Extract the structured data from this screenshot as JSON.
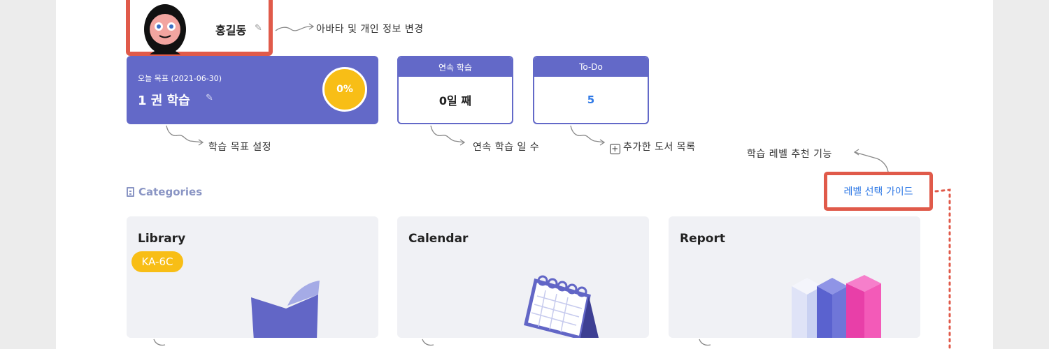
{
  "profile": {
    "name": "홍길동",
    "edit_icon": "pencil-icon"
  },
  "notes": {
    "avatar": "아바타 및 개인 정보 변경",
    "goal": "학습 목표 설정",
    "streak": "연속 학습 일 수",
    "todo": "추가한 도서 목록",
    "level": "학습 레벨 추천 기능"
  },
  "goal": {
    "date_label": "오늘 목표 (2021-06-30)",
    "title": "1 권 학습",
    "progress_text": "0%",
    "progress": 0
  },
  "streak": {
    "header": "연속 학습",
    "value": "0일 째"
  },
  "todo": {
    "header": "To-Do",
    "value": "5"
  },
  "categories": {
    "label": "Categories",
    "guide_link": "레벨 선택 가이드"
  },
  "cards": [
    {
      "title": "Library",
      "badge": "KA-6C"
    },
    {
      "title": "Calendar"
    },
    {
      "title": "Report"
    }
  ],
  "colors": {
    "accent": "#6369c8",
    "highlight": "#e05a4a",
    "badge": "#f8be16",
    "link": "#2f79e6"
  }
}
